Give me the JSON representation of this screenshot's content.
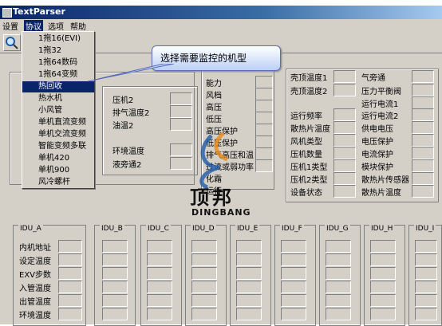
{
  "window": {
    "title": "TextParser"
  },
  "menu": [
    "设置",
    "协议",
    "选项",
    "帮助"
  ],
  "protocol_menu": {
    "items": [
      "1拖16(EVI)",
      "1拖32",
      "1拖64数码",
      "1拖64变频",
      "热回收",
      "热水机",
      "小风管",
      "单机直流变频",
      "单机交流变频",
      "智能变频多联",
      "单机420",
      "单机900",
      "风冷螺杆"
    ],
    "selected": "热回收"
  },
  "callout": "选择需要监控的机型",
  "middle_labels": [
    "压机2",
    "排气温度2",
    "油温2",
    "环境温度",
    "液旁通2"
  ],
  "center_labels": [
    "能力",
    "风档",
    "高压",
    "低压",
    "高压保护",
    "低压保护",
    "排气高压和温",
    "过流或弱功率",
    "化霜",
    "运行"
  ],
  "right_labels_a": [
    "壳顶温度1",
    "壳顶温度2",
    "运行频率",
    "散热片温度",
    "风机类型",
    "压机数量",
    "压机1类型",
    "压机2类型",
    "设备状态"
  ],
  "right_labels_b": [
    "气旁通",
    "压力平衡阀",
    "运行电流1",
    "运行电流2",
    "供电电压",
    "电压保护",
    "电流保护",
    "模块保护",
    "散热片传感器",
    "散热片温度"
  ],
  "idu": {
    "headers": [
      "IDU_A",
      "IDU_B",
      "IDU_C",
      "IDU_D",
      "IDU_E",
      "IDU_F",
      "IDU_G",
      "IDU_H",
      "IDU_I"
    ],
    "row_labels": [
      "内机地址",
      "设定温度",
      "EXV步数",
      "入管温度",
      "出管温度",
      "环境温度"
    ]
  },
  "watermark": {
    "brand_cn": "顶邦",
    "brand_en": "DINGBANG"
  },
  "colors": {
    "accent": "#0a246a",
    "face": "#d4d0c8",
    "callout_border": "#5a6fb8",
    "logo_blue": "#1e5aa8",
    "logo_orange": "#e88a1a"
  }
}
